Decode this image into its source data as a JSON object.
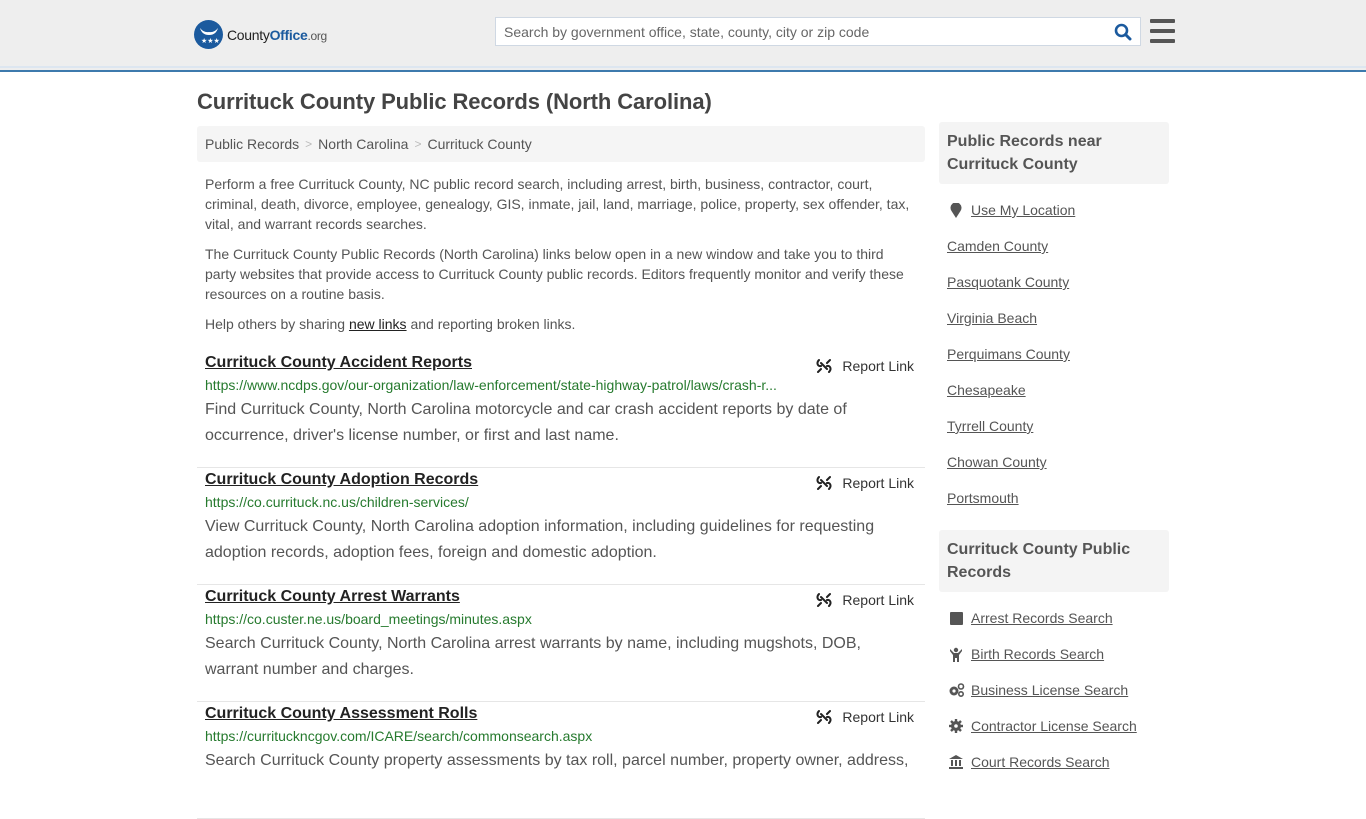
{
  "header": {
    "logo": {
      "part1": "County",
      "part2": "Office",
      "part3": ".org"
    },
    "search_placeholder": "Search by government office, state, county, city or zip code",
    "search_value": ""
  },
  "page": {
    "title": "Currituck County Public Records (North Carolina)",
    "breadcrumb": [
      "Public Records",
      "North Carolina",
      "Currituck County"
    ],
    "intro": {
      "p1": "Perform a free Currituck County, NC public record search, including arrest, birth, business, contractor, court, criminal, death, divorce, employee, genealogy, GIS, inmate, jail, land, marriage, police, property, sex offender, tax, vital, and warrant records searches.",
      "p2": "The Currituck County Public Records (North Carolina) links below open in a new window and take you to third party websites that provide access to Currituck County public records. Editors frequently monitor and verify these resources on a routine basis.",
      "p3_before": "Help others by sharing ",
      "p3_link": "new links",
      "p3_after": " and reporting broken links."
    },
    "report_label": "Report Link",
    "records": [
      {
        "title": "Currituck County Accident Reports",
        "url": "https://www.ncdps.gov/our-organization/law-enforcement/state-highway-patrol/laws/crash-r...",
        "desc": "Find Currituck County, North Carolina motorcycle and car crash accident reports by date of occurrence, driver's license number, or first and last name."
      },
      {
        "title": "Currituck County Adoption Records",
        "url": "https://co.currituck.nc.us/children-services/",
        "desc": "View Currituck County, North Carolina adoption information, including guidelines for requesting adoption records, adoption fees, foreign and domestic adoption."
      },
      {
        "title": "Currituck County Arrest Warrants",
        "url": "https://co.custer.ne.us/board_meetings/minutes.aspx",
        "desc": "Search Currituck County, North Carolina arrest warrants by name, including mugshots, DOB, warrant number and charges."
      },
      {
        "title": "Currituck County Assessment Rolls",
        "url": "https://currituckncgov.com/ICARE/search/commonsearch.aspx",
        "desc": "Search Currituck County property assessments by tax roll, parcel number, property owner, address,"
      }
    ]
  },
  "sidebar": {
    "nearby": {
      "heading": "Public Records near Currituck County",
      "use_location": "Use My Location",
      "items": [
        "Camden County",
        "Pasquotank County",
        "Virginia Beach",
        "Perquimans County",
        "Chesapeake",
        "Tyrrell County",
        "Chowan County",
        "Portsmouth"
      ]
    },
    "county_records": {
      "heading": "Currituck County Public Records",
      "items": [
        {
          "label": "Arrest Records Search",
          "icon": "square-icon"
        },
        {
          "label": "Birth Records Search",
          "icon": "child-icon"
        },
        {
          "label": "Business License Search",
          "icon": "cogs-icon"
        },
        {
          "label": "Contractor License Search",
          "icon": "cog-icon"
        },
        {
          "label": "Court Records Search",
          "icon": "courthouse-icon"
        }
      ]
    }
  },
  "colors": {
    "brand_blue": "#1b5a9e",
    "header_border": "#3d7aad",
    "url_green": "#267a2e"
  }
}
